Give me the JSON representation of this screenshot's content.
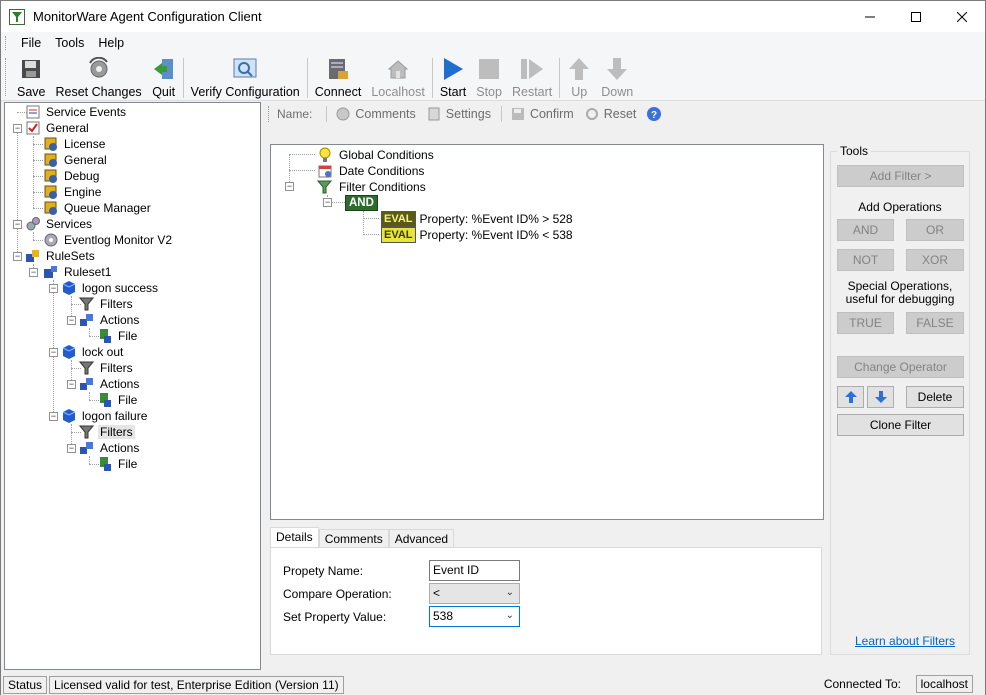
{
  "window": {
    "title": "MonitorWare Agent Configuration Client"
  },
  "menu": [
    "File",
    "Tools",
    "Help"
  ],
  "toolbar": {
    "save": "Save",
    "reset_changes": "Reset Changes",
    "quit": "Quit",
    "verify": "Verify Configuration",
    "connect": "Connect",
    "localhost": "Localhost",
    "start": "Start",
    "stop": "Stop",
    "restart": "Restart",
    "up": "Up",
    "down": "Down"
  },
  "tree": {
    "service_events": "Service Events",
    "general": "General",
    "license": "License",
    "general_child": "General",
    "debug": "Debug",
    "engine": "Engine",
    "queue_manager": "Queue Manager",
    "services": "Services",
    "eventlog_monitor": "Eventlog Monitor V2",
    "rulesets": "RuleSets",
    "ruleset1": "Ruleset1",
    "logon_success": "logon success",
    "lock_out": "lock out",
    "logon_failure": "logon failure",
    "filters": "Filters",
    "actions": "Actions",
    "file": "File"
  },
  "subbar": {
    "name": "Name:",
    "comments": "Comments",
    "settings": "Settings",
    "confirm": "Confirm",
    "reset": "Reset"
  },
  "filter_tree": {
    "global_conditions": "Global Conditions",
    "date_conditions": "Date Conditions",
    "filter_conditions": "Filter Conditions",
    "and": "AND",
    "eval_label": "EVAL",
    "eval1": "Property: %Event ID% >  528",
    "eval2": "Property: %Event ID% < 538"
  },
  "tabs": [
    "Details",
    "Comments",
    "Advanced"
  ],
  "details": {
    "property_name_label": "Propety Name:",
    "property_name_value": "Event ID",
    "compare_label": "Compare Operation:",
    "compare_value": "<",
    "set_value_label": "Set Property Value:",
    "set_value_value": "538"
  },
  "tools": {
    "title": "Tools",
    "add_filter": "Add Filter >",
    "add_operations": "Add Operations",
    "and": "AND",
    "or": "OR",
    "not": "NOT",
    "xor": "XOR",
    "special_ops": "Special Operations,",
    "special_ops2": "useful for debugging",
    "true": "TRUE",
    "false": "FALSE",
    "change_operator": "Change Operator",
    "delete": "Delete",
    "clone_filter": "Clone Filter",
    "learn": "Learn about Filters"
  },
  "status": {
    "label": "Status",
    "license": "Licensed valid for test, Enterprise Edition (Version 11)",
    "connected_to": "Connected To:",
    "host": "localhost"
  }
}
